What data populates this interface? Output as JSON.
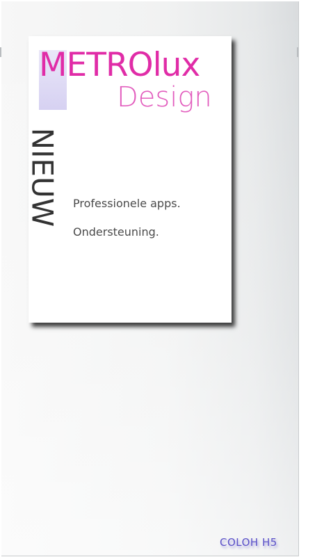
{
  "logo": {
    "main": "METROlux",
    "sub": "Design"
  },
  "card": {
    "vertical_label": "NIEUW",
    "features": [
      "Professionele apps.",
      "Ondersteuning."
    ]
  },
  "footer": {
    "brand": "COLOH H5"
  },
  "colors": {
    "logo_main": "#e02ca7",
    "logo_sub": "#e25cbd",
    "accent_block": "#d6d1f2",
    "footer_brand": "#5a50c8"
  }
}
